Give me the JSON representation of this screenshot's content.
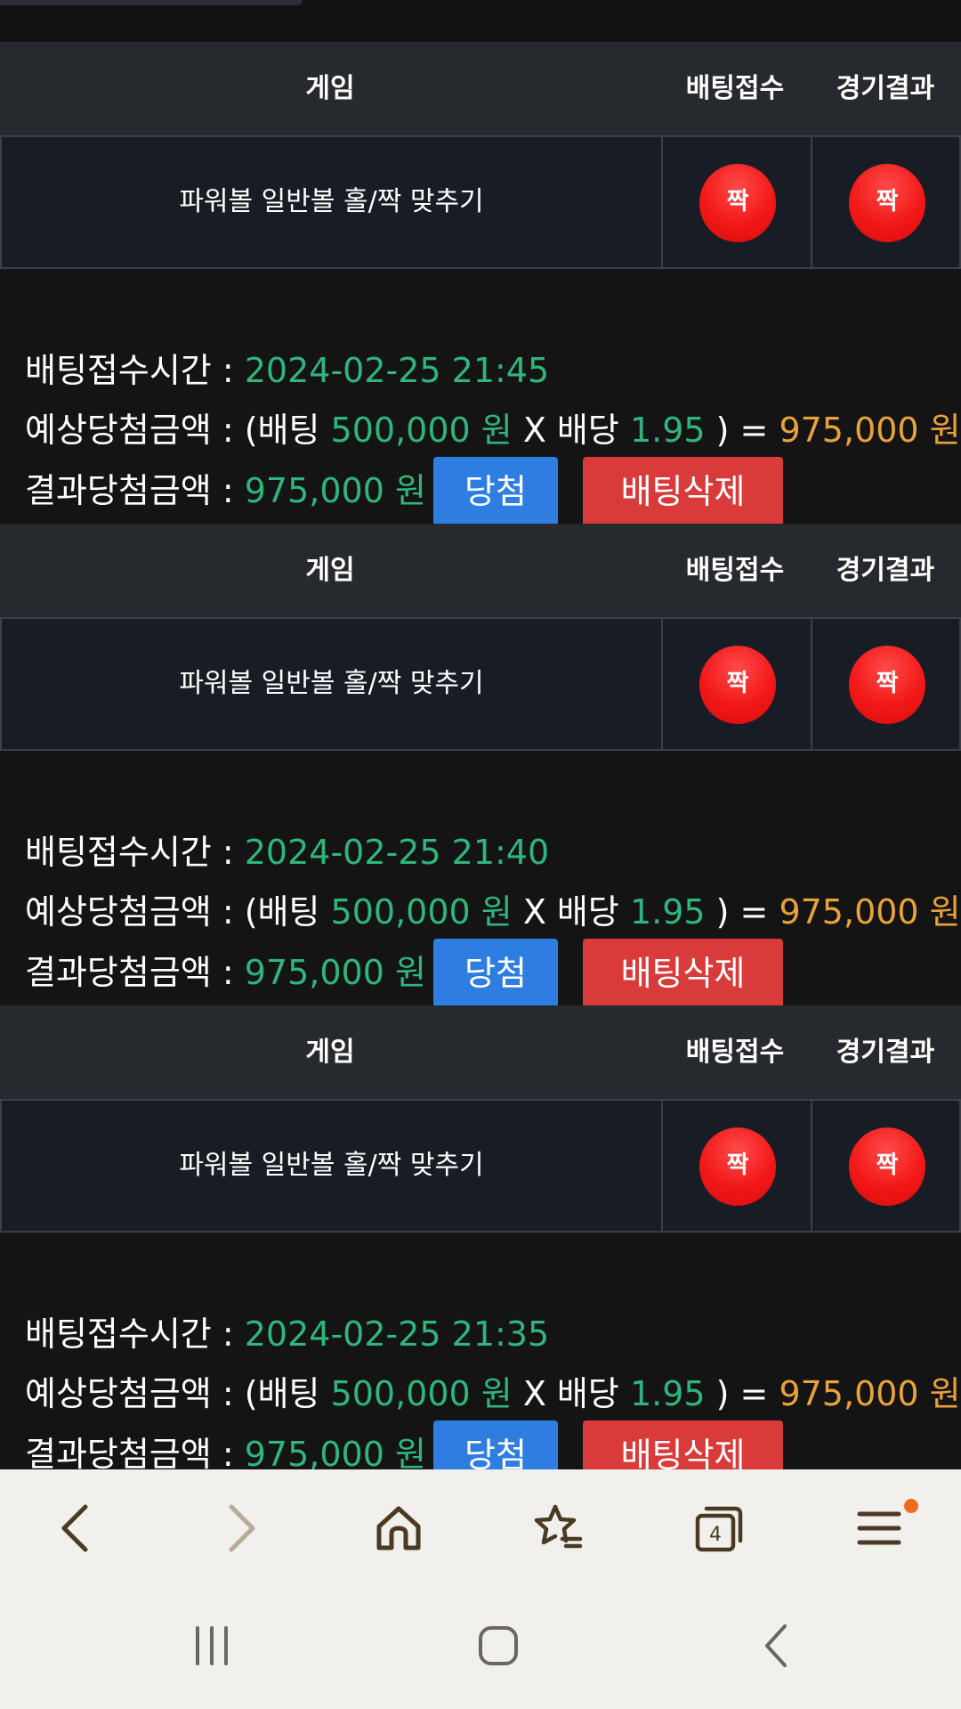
{
  "table_header": {
    "game": "게임",
    "accepted": "배팅접수",
    "result": "경기결과"
  },
  "labels": {
    "bet_time": "배팅접수시간 : ",
    "expected": "예상당첨금액 : (배팅 ",
    "times": " X 배당 ",
    "close_eq": " ) = ",
    "result_amount": "결과당첨금액 : "
  },
  "bets": [
    {
      "game": "파워볼 일반볼 홀/짝 맞추기",
      "accepted_pick": "짝",
      "result_pick": "짝",
      "time": "2024-02-25 21:45",
      "stake": "500,000 원",
      "odds": "1.95",
      "expected_win": "975,000 원",
      "result_win": "975,000 원",
      "status_button": "당첨",
      "delete_button": "배팅삭제"
    },
    {
      "game": "파워볼 일반볼 홀/짝 맞추기",
      "accepted_pick": "짝",
      "result_pick": "짝",
      "time": "2024-02-25 21:40",
      "stake": "500,000 원",
      "odds": "1.95",
      "expected_win": "975,000 원",
      "result_win": "975,000 원",
      "status_button": "당첨",
      "delete_button": "배팅삭제"
    },
    {
      "game": "파워볼 일반볼 홀/짝 맞추기",
      "accepted_pick": "짝",
      "result_pick": "짝",
      "time": "2024-02-25 21:35",
      "stake": "500,000 원",
      "odds": "1.95",
      "expected_win": "975,000 원",
      "result_win": "975,000 원",
      "status_button": "당첨",
      "delete_button": "배팅삭제"
    }
  ],
  "browser_nav": {
    "items": [
      "back-icon",
      "forward-icon",
      "home-icon",
      "bookmarks-star-icon",
      "tabs-icon",
      "menu-icon"
    ],
    "tab_count": "4",
    "menu_badge_color": "#f26a1b"
  },
  "system_nav": {
    "items": [
      "recent-apps-icon",
      "home-button-icon",
      "system-back-icon"
    ]
  },
  "colors": {
    "accent_green": "#2fb67c",
    "accent_orange": "#e8a23b",
    "win_button": "#2e7de0",
    "delete_button": "#d93a3a",
    "ball_red": "#f21818"
  }
}
